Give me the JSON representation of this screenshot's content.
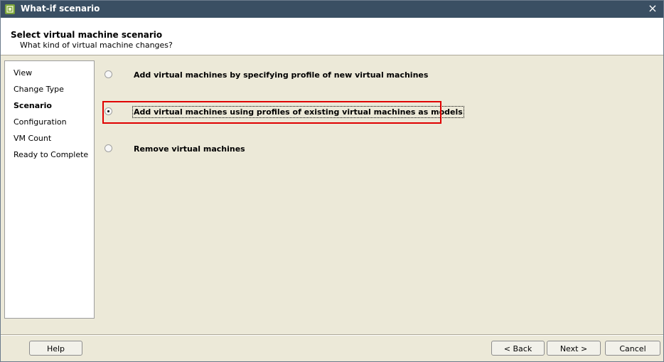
{
  "window": {
    "title": "What-if scenario",
    "close_glyph": "×",
    "icon": "vm-icon"
  },
  "header": {
    "title": "Select virtual machine scenario",
    "subtitle": "What kind of virtual machine changes?"
  },
  "steps": [
    {
      "label": "View",
      "active": false
    },
    {
      "label": "Change Type",
      "active": false
    },
    {
      "label": "Scenario",
      "active": true
    },
    {
      "label": "Configuration",
      "active": false
    },
    {
      "label": "VM Count",
      "active": false
    },
    {
      "label": "Ready to Complete",
      "active": false
    }
  ],
  "options": [
    {
      "label": "Add virtual machines by specifying profile of new virtual machines",
      "selected": false
    },
    {
      "label": "Add virtual machines using profiles of existing virtual machines as models",
      "selected": true
    },
    {
      "label": "Remove virtual machines",
      "selected": false
    }
  ],
  "buttons": {
    "help": "Help",
    "back": "< Back",
    "next": "Next >",
    "cancel": "Cancel"
  },
  "colors": {
    "titlebar": "#3a4f63",
    "highlight": "#e00000",
    "dialog_bg": "#ece9d8"
  }
}
